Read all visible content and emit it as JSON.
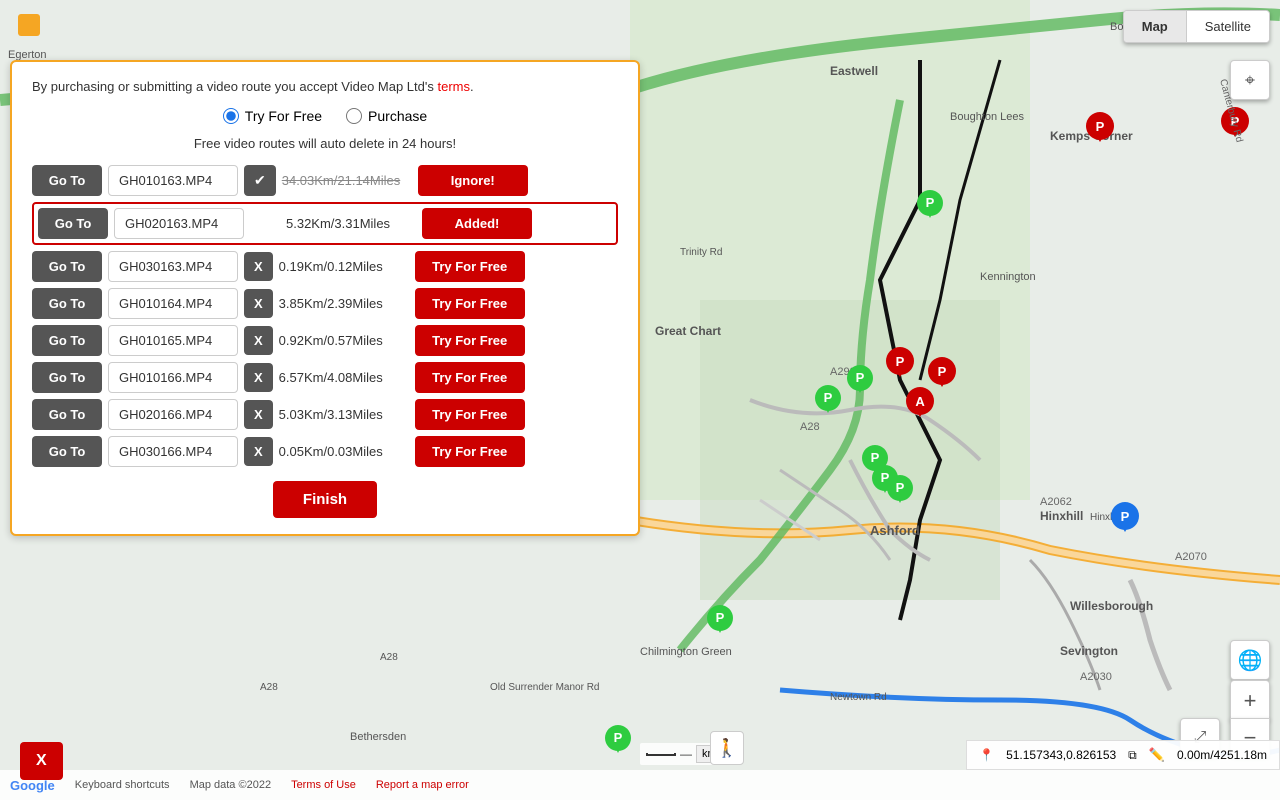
{
  "map": {
    "type_buttons": [
      "Map",
      "Satellite"
    ],
    "active_type": "Map",
    "coords": "51.157343,0.826153",
    "distance": "0.00m/4251.18m",
    "keyboard_shortcuts": "Keyboard shortcuts",
    "map_data": "Map data ©2022",
    "terms": "Terms of Use",
    "report": "Report a map error"
  },
  "panel": {
    "terms_text": "By purchasing or submitting a video route you accept Video Map Ltd's",
    "terms_link": "terms",
    "terms_period": ".",
    "radio_options": [
      "Try For Free",
      "Purchase"
    ],
    "selected_radio": "Try For Free",
    "auto_delete_text": "Free video routes will auto delete in 24 hours!",
    "routes": [
      {
        "goto_label": "Go To",
        "filename": "GH010163.MP4",
        "action_icon": "check",
        "distance": "34.03Km/21.14Miles",
        "strikethrough": true,
        "action_label": "Ignore!",
        "action_type": "ignore"
      },
      {
        "goto_label": "Go To",
        "filename": "GH020163.MP4",
        "action_icon": null,
        "distance": "5.32Km/3.31Miles",
        "strikethrough": false,
        "action_label": "Added!",
        "action_type": "added",
        "highlighted": true
      },
      {
        "goto_label": "Go To",
        "filename": "GH030163.MP4",
        "action_icon": "x",
        "distance": "0.19Km/0.12Miles",
        "strikethrough": false,
        "action_label": "Try For Free",
        "action_type": "try"
      },
      {
        "goto_label": "Go To",
        "filename": "GH010164.MP4",
        "action_icon": "x",
        "distance": "3.85Km/2.39Miles",
        "strikethrough": false,
        "action_label": "Try For Free",
        "action_type": "try"
      },
      {
        "goto_label": "Go To",
        "filename": "GH010165.MP4",
        "action_icon": "x",
        "distance": "0.92Km/0.57Miles",
        "strikethrough": false,
        "action_label": "Try For Free",
        "action_type": "try"
      },
      {
        "goto_label": "Go To",
        "filename": "GH010166.MP4",
        "action_icon": "x",
        "distance": "6.57Km/4.08Miles",
        "strikethrough": false,
        "action_label": "Try For Free",
        "action_type": "try"
      },
      {
        "goto_label": "Go To",
        "filename": "GH020166.MP4",
        "action_icon": "x",
        "distance": "5.03Km/3.13Miles",
        "strikethrough": false,
        "action_label": "Try For Free",
        "action_type": "try"
      },
      {
        "goto_label": "Go To",
        "filename": "GH030166.MP4",
        "action_icon": "x",
        "distance": "0.05Km/0.03Miles",
        "strikethrough": false,
        "action_label": "Try For Free",
        "action_type": "try"
      }
    ],
    "finish_label": "Finish",
    "x_corner_label": "X"
  }
}
